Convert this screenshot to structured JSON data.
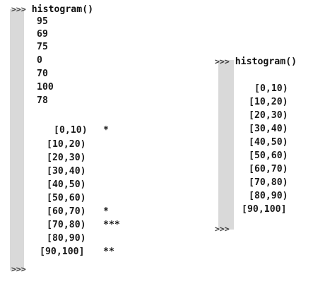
{
  "left_console": {
    "prompt": ">>>",
    "command": "histogram()",
    "inputs": [
      "95",
      "69",
      "75",
      "0",
      "70",
      "100",
      "78"
    ],
    "bins": [
      {
        "range": "[0,10)",
        "stars": "*"
      },
      {
        "range": "[10,20)",
        "stars": ""
      },
      {
        "range": "[20,30)",
        "stars": ""
      },
      {
        "range": "[30,40)",
        "stars": ""
      },
      {
        "range": "[40,50)",
        "stars": ""
      },
      {
        "range": "[50,60)",
        "stars": ""
      },
      {
        "range": "[60,70)",
        "stars": "*"
      },
      {
        "range": "[70,80)",
        "stars": "***"
      },
      {
        "range": "[80,90)",
        "stars": ""
      },
      {
        "range": "[90,100]",
        "stars": "**"
      }
    ],
    "end_prompt": ">>>"
  },
  "right_console": {
    "prompt": ">>>",
    "command": "histogram()",
    "bins": [
      {
        "range": "[0,10)"
      },
      {
        "range": "[10,20)"
      },
      {
        "range": "[20,30)"
      },
      {
        "range": "[30,40)"
      },
      {
        "range": "[40,50)"
      },
      {
        "range": "[50,60)"
      },
      {
        "range": "[60,70)"
      },
      {
        "range": "[70,80)"
      },
      {
        "range": "[80,90)"
      },
      {
        "range": "[90,100]"
      }
    ],
    "end_prompt": ">>>"
  }
}
